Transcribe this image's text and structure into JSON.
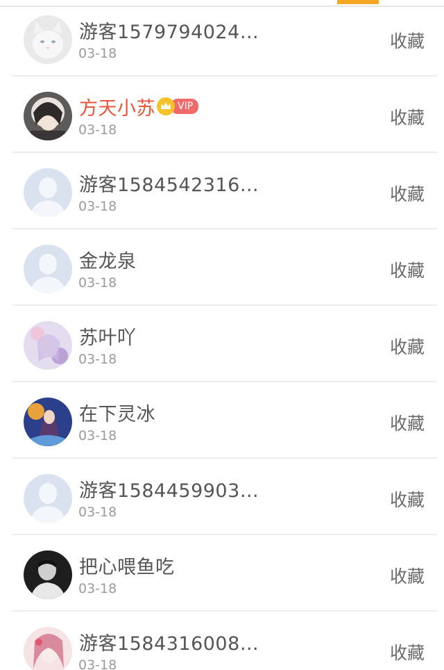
{
  "list": {
    "rows": [
      {
        "name": "游客1579794024…",
        "date": "03-18",
        "action": "收藏",
        "avatar": "white-cat-avatar"
      },
      {
        "name": "方天小苏",
        "date": "03-18",
        "action": "收藏",
        "avatar": "anime-girl-avatar",
        "vip": "VIP"
      },
      {
        "name": "游客1584542316…",
        "date": "03-18",
        "action": "收藏",
        "avatar": "default-user-avatar"
      },
      {
        "name": "金龙泉",
        "date": "03-18",
        "action": "收藏",
        "avatar": "default-user-avatar"
      },
      {
        "name": "苏叶吖",
        "date": "03-18",
        "action": "收藏",
        "avatar": "purple-anime-avatar"
      },
      {
        "name": "在下灵冰",
        "date": "03-18",
        "action": "收藏",
        "avatar": "fantasy-character-avatar"
      },
      {
        "name": "游客1584459903…",
        "date": "03-18",
        "action": "收藏",
        "avatar": "default-user-avatar"
      },
      {
        "name": "把心喂鱼吃",
        "date": "03-18",
        "action": "收藏",
        "avatar": "dark-photo-avatar"
      },
      {
        "name": "游客1584316008…",
        "date": "03-18",
        "action": "收藏",
        "avatar": "pink-anime-avatar"
      }
    ]
  },
  "colors": {
    "accent": "#f5a623",
    "vip_name": "#e8553a",
    "vip_tag": "#ef6b6b",
    "text": "#555555",
    "muted": "#9b9b9b"
  }
}
